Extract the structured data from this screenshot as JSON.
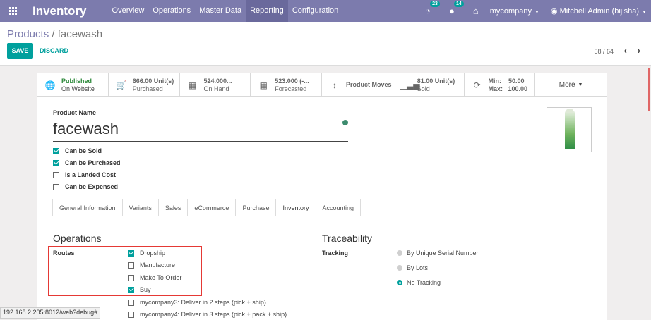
{
  "navbar": {
    "brand": "Inventory",
    "menu": [
      "Overview",
      "Operations",
      "Master Data",
      "Reporting",
      "Configuration"
    ],
    "active_menu": "Reporting",
    "activity_count": "23",
    "message_count": "14",
    "company": "mycompany",
    "user": "Mitchell Admin (bijisha)"
  },
  "breadcrumb": {
    "parent": "Products",
    "separator": "/",
    "current": "facewash"
  },
  "buttons": {
    "save": "SAVE",
    "discard": "DISCARD"
  },
  "pager": {
    "text": "58 / 64"
  },
  "stats": [
    {
      "icon": "globe-icon",
      "line1": "Published",
      "line2": "On Website"
    },
    {
      "icon": "cart-icon",
      "line1": "666.00 Unit(s)",
      "line2": "Purchased"
    },
    {
      "icon": "building-icon",
      "line1": "524.000...",
      "line2": "On Hand"
    },
    {
      "icon": "building-icon",
      "line1": "523.000 (-...",
      "line2": "Forecasted"
    },
    {
      "icon": "arrows-v-icon",
      "line1": "Product Moves",
      "line2": ""
    },
    {
      "icon": "bar-chart-icon",
      "line1": "81.00 Unit(s)",
      "line2": "Sold"
    },
    {
      "icon": "refresh-icon",
      "line1": "Min:    50.00",
      "line2": "Max:   100.00"
    },
    {
      "icon": "",
      "line1": "More",
      "line2": ""
    }
  ],
  "product": {
    "name_label": "Product Name",
    "name": "facewash",
    "checks": [
      {
        "label": "Can be Sold",
        "checked": true
      },
      {
        "label": "Can be Purchased",
        "checked": true
      },
      {
        "label": "Is a Landed Cost",
        "checked": false
      },
      {
        "label": "Can be Expensed",
        "checked": false
      }
    ]
  },
  "tabs": [
    "General Information",
    "Variants",
    "Sales",
    "eCommerce",
    "Purchase",
    "Inventory",
    "Accounting"
  ],
  "active_tab": "Inventory",
  "operations": {
    "title": "Operations",
    "routes_label": "Routes",
    "routes": [
      {
        "label": "Dropship",
        "checked": true
      },
      {
        "label": "Manufacture",
        "checked": false
      },
      {
        "label": "Make To Order",
        "checked": false
      },
      {
        "label": "Buy",
        "checked": true
      },
      {
        "label": "mycompany3: Deliver in 2 steps (pick + ship)",
        "checked": false
      },
      {
        "label": "mycompany4: Deliver in 3 steps (pick + pack + ship)",
        "checked": false
      }
    ]
  },
  "traceability": {
    "title": "Traceability",
    "tracking_label": "Tracking",
    "options": [
      {
        "label": "By Unique Serial Number",
        "selected": false
      },
      {
        "label": "By Lots",
        "selected": false
      },
      {
        "label": "No Tracking",
        "selected": true
      }
    ]
  },
  "status_url": "192.168.2.205:8012/web?debug#"
}
